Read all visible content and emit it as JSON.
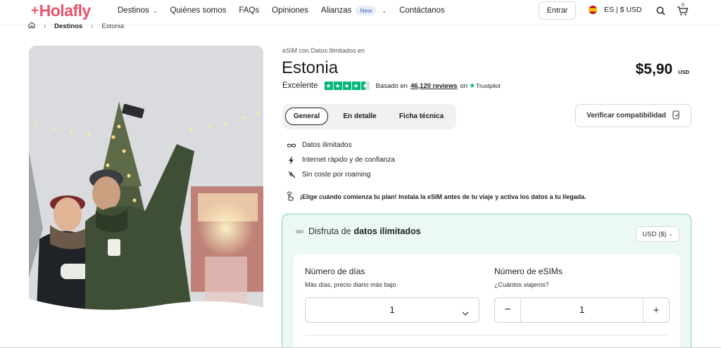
{
  "brand": {
    "logo_text": "Holafly",
    "accent": "#e8546b"
  },
  "nav": {
    "items": [
      {
        "label": "Destinos",
        "has_dropdown": true
      },
      {
        "label": "Quiénes somos"
      },
      {
        "label": "FAQs"
      },
      {
        "label": "Opiniones"
      },
      {
        "label": "Alianzas",
        "badge": "New",
        "has_dropdown": true
      },
      {
        "label": "Contáctanos"
      }
    ],
    "login_label": "Entrar",
    "locale_label": "ES | $ USD",
    "search_icon": "search-icon",
    "cart_icon": "cart-icon",
    "cart_count": "0"
  },
  "breadcrumb": {
    "home_icon": "home-icon",
    "items": [
      "Destinos",
      "Estonia"
    ]
  },
  "hero": {
    "image": "photo-couple-selfie-christmas-market"
  },
  "product": {
    "pre_title": "eSIM con Datos Ilimitados en",
    "title": "Estonia",
    "price": "$5,90",
    "currency": "USD",
    "rating_word": "Excelente",
    "rating_stars": 4.5,
    "reviews_prefix": "Basado en",
    "reviews_count": "46,120 reviews",
    "reviews_on": "on",
    "reviews_platform": "Trustpilot",
    "trustpilot_color": "#00b67a"
  },
  "tabs": [
    "General",
    "En detalle",
    "Ficha técnica"
  ],
  "active_tab": 0,
  "compat_button": "Verificar compatibilidad",
  "features": [
    {
      "icon": "infinity-icon",
      "label": "Datos ilimitados"
    },
    {
      "icon": "bolt-icon",
      "label": "Internet rápido y de confianza"
    },
    {
      "icon": "no-roaming-icon",
      "label": "Sin coste por roaming"
    }
  ],
  "notice": {
    "icon": "hand-tap-icon",
    "text": "¡Elige cuándo comienza tu plan! Instala la eSIM antes de tu viaje y activa los datos a tu llegada."
  },
  "plan": {
    "heading_prefix": "Disfruta de",
    "heading_bold": "datos ilimitados",
    "currency_select": "USD ($)",
    "days_label": "Número de días",
    "days_sub": "Más días, precio diario más bajo",
    "days_value": "1",
    "esims_label": "Número de eSIMs",
    "esims_sub": "¿Cuántos viajeros?",
    "esims_value": "1",
    "border_color": "#7dd8a9",
    "bg_color": "#ebf8f6"
  }
}
